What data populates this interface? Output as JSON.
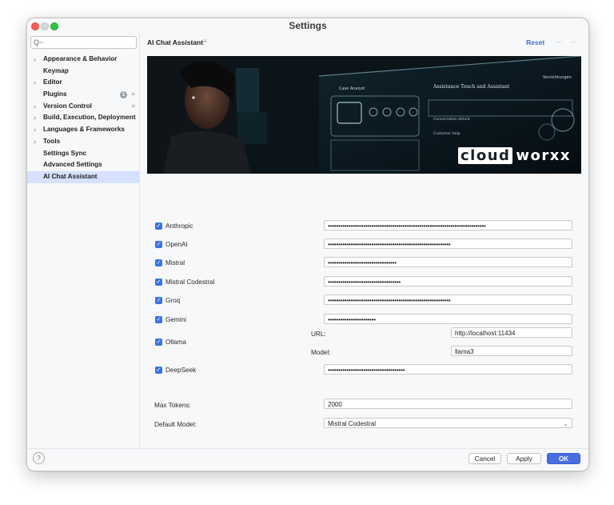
{
  "window": {
    "title": "Settings"
  },
  "search": {
    "placeholder": "Q~"
  },
  "sidebar": {
    "items": [
      {
        "label": "Appearance & Behavior",
        "chevron": true
      },
      {
        "label": "Keymap",
        "chevron": false
      },
      {
        "label": "Editor",
        "chevron": true
      },
      {
        "label": "Plugins",
        "chevron": false,
        "badge": "1",
        "menu": true
      },
      {
        "label": "Version Control",
        "chevron": true,
        "menu": true
      },
      {
        "label": "Build, Execution, Deployment",
        "chevron": true
      },
      {
        "label": "Languages & Frameworks",
        "chevron": true
      },
      {
        "label": "Tools",
        "chevron": true
      },
      {
        "label": "Settings Sync",
        "chevron": false
      },
      {
        "label": "Advanced Settings",
        "chevron": false
      },
      {
        "label": "AI Chat Assistant",
        "chevron": false,
        "selected": true
      }
    ]
  },
  "header": {
    "title": "AI Chat Assistant",
    "reset": "Reset",
    "back_icon": "arrow-left-icon",
    "forward_icon": "arrow-right-icon"
  },
  "banner": {
    "logo_part1": "cloud",
    "logo_part2": "worxx",
    "screen_texts": [
      "Case Analyst",
      "Assistance Touch and Assistant",
      "Conversation details",
      "Customer Help",
      "Vorsichtungen"
    ]
  },
  "providers": [
    {
      "name": "Anthropic",
      "checked": true,
      "value": "••••••••••••••••••••••••••••••••••••••••••••••••••••••••••••••••••••••••••••"
    },
    {
      "name": "OpenAI",
      "checked": true,
      "value": "•••••••••••••••••••••••••••••••••••••••••••••••••••••••••••"
    },
    {
      "name": "Mistral",
      "checked": true,
      "value": "•••••••••••••••••••••••••••••••••"
    },
    {
      "name": "Mistral Codestral",
      "checked": true,
      "value": "•••••••••••••••••••••••••••••••••••"
    },
    {
      "name": "Groq",
      "checked": true,
      "value": "•••••••••••••••••••••••••••••••••••••••••••••••••••••••••••"
    },
    {
      "name": "Gemini",
      "checked": true,
      "value": "•••••••••••••••••••••••"
    }
  ],
  "ollama": {
    "name": "Ollama",
    "checked": true,
    "url_label": "URL:",
    "url": "http://localhost:11434",
    "model_label": "Model:",
    "model": "llama3"
  },
  "deepseek": {
    "name": "DeepSeek",
    "checked": true,
    "value": "•••••••••••••••••••••••••••••••••••••"
  },
  "max_tokens": {
    "label": "Max Tokens:",
    "value": "2000"
  },
  "default_model": {
    "label": "Default Model:",
    "value": "Mistral Codestral"
  },
  "footer": {
    "help": "?",
    "cancel": "Cancel",
    "apply": "Apply",
    "ok": "OK"
  },
  "colors": {
    "accent": "#4a6ee0",
    "selection": "#d5e1ff",
    "checkbox": "#3a74e8",
    "link": "#3c6fd8"
  }
}
